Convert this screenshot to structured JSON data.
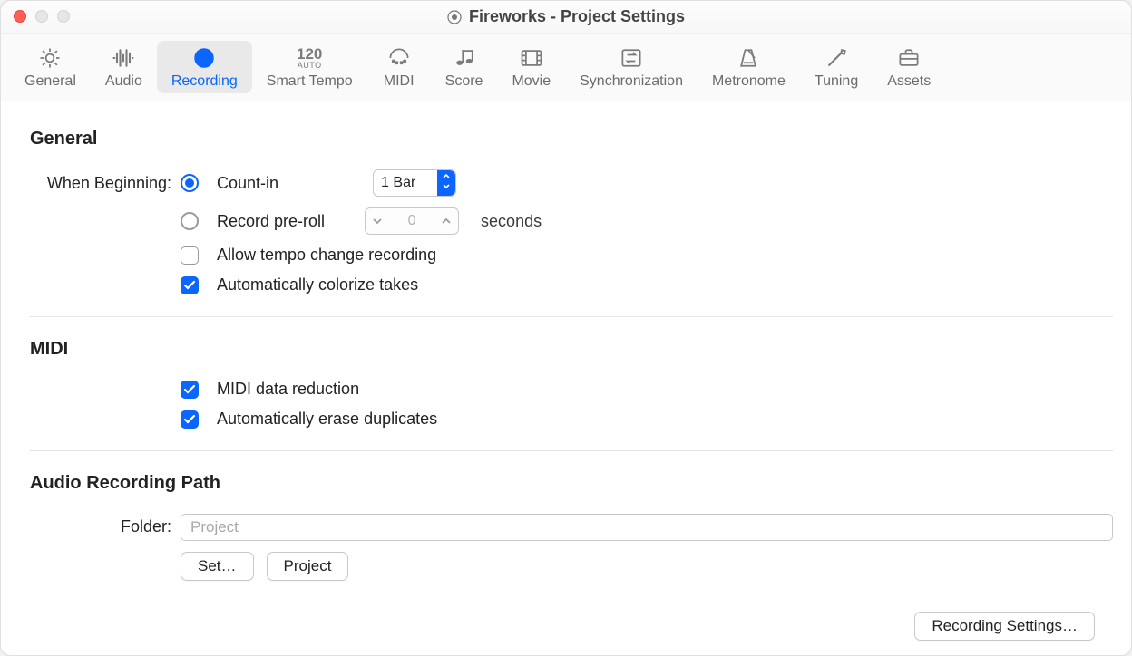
{
  "window_title": "Fireworks - Project Settings",
  "toolbar_tabs": [
    {
      "id": "general",
      "label": "General"
    },
    {
      "id": "audio",
      "label": "Audio"
    },
    {
      "id": "recording",
      "label": "Recording",
      "selected": true
    },
    {
      "id": "smarttempo",
      "label": "Smart Tempo"
    },
    {
      "id": "midi",
      "label": "MIDI"
    },
    {
      "id": "score",
      "label": "Score"
    },
    {
      "id": "movie",
      "label": "Movie"
    },
    {
      "id": "synchronization",
      "label": "Synchronization"
    },
    {
      "id": "metronome",
      "label": "Metronome"
    },
    {
      "id": "tuning",
      "label": "Tuning"
    },
    {
      "id": "assets",
      "label": "Assets"
    }
  ],
  "sections": {
    "general": {
      "title": "General",
      "when_beginning_label": "When Beginning:",
      "count_in_label": "Count-in",
      "count_in_value": "1 Bar",
      "pre_roll_label": "Record pre-roll",
      "pre_roll_value": "0",
      "pre_roll_units": "seconds",
      "allow_tempo_label": "Allow tempo change recording",
      "colorize_label": "Automatically colorize takes"
    },
    "midi": {
      "title": "MIDI",
      "reduction_label": "MIDI data reduction",
      "erase_dup_label": "Automatically erase duplicates"
    },
    "path": {
      "title": "Audio Recording Path",
      "folder_label": "Folder:",
      "folder_placeholder": "Project",
      "set_btn": "Set…",
      "project_btn": "Project"
    }
  },
  "footer_button": "Recording Settings…"
}
